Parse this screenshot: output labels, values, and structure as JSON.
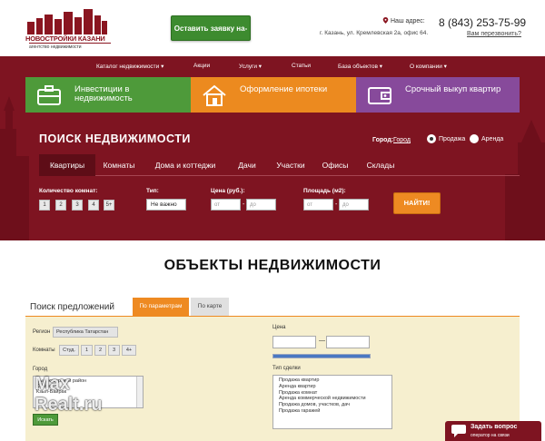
{
  "header": {
    "logo_name": "НОВОСТРОЙКИ КАЗАНИ",
    "logo_sub": "агентство недвижимости",
    "cta": "Оставить заявку на-",
    "address_label": "Наш адрес:",
    "address": "г. Казань, ул. Кремлевская 2а, офис 64.",
    "phone": "8 (843) 253-75-99",
    "callback": "Вам перезвонить?"
  },
  "nav": {
    "items": [
      "Каталог недвижимости",
      "Акции",
      "Услуги",
      "Статьи",
      "База объектов",
      "О компании"
    ]
  },
  "services": {
    "items": [
      {
        "label": "Инвестиции в недвижимость",
        "icon": "briefcase-icon",
        "color": "#4e9a3a"
      },
      {
        "label": "Оформление ипотеки",
        "icon": "house-icon",
        "color": "#ec8a1f"
      },
      {
        "label": "Срочный выкуп квартир",
        "icon": "wallet-icon",
        "color": "#874a9b"
      }
    ]
  },
  "search": {
    "title": "ПОИСК НЕДВИЖИМОСТИ",
    "city_label": "Город:",
    "city": "Город",
    "mode_sale": "Продажа",
    "mode_rent": "Аренда",
    "tabs": [
      "Квартиры",
      "Комнаты",
      "Дома и коттеджи",
      "Дачи",
      "Участки",
      "Офисы",
      "Склады"
    ],
    "rooms_label": "Количество комнат:",
    "rooms": [
      "1",
      "2",
      "3",
      "4",
      "5+"
    ],
    "type_label": "Тип:",
    "type_value": "Не важно",
    "price_label": "Цена (руб.):",
    "area_label": "Площадь (м2):",
    "from_ph": "от",
    "to_ph": "до",
    "find": "НАЙТИ!"
  },
  "objects": {
    "title": "ОБЪЕКТЫ НЕДВИЖИМОСТИ",
    "offer_title": "Поиск предложений",
    "tab_params": "По параметрам",
    "tab_map": "По карте",
    "region_label": "Регион",
    "region_value": "Республика Татарстан",
    "rooms_label": "Комнаты",
    "rooms": [
      "Студ.",
      "1",
      "2",
      "3",
      "4+"
    ],
    "city_label": "Город",
    "cities": [
      "Высокогорский район",
      "Казань",
      "Кзыл-Байрак"
    ],
    "show": "Искать",
    "price_label": "Цена",
    "deal_label": "Тип сделки",
    "deals": [
      "Продажа квартир",
      "Аренда квартир",
      "Продажа комнат",
      "Аренда коммерческой недвижимости",
      "Продажа домов, участков, дач",
      "Продажа гаражей"
    ]
  },
  "watermark": {
    "line1": "Max",
    "line2": "Realt.ru"
  },
  "widget": {
    "title": "Задать вопрос",
    "subtitle": "оператор на связи"
  },
  "colors": {
    "maroon": "#7e1421",
    "green": "#4e9a3a",
    "orange": "#ec8a1f",
    "purple": "#874a9b"
  }
}
